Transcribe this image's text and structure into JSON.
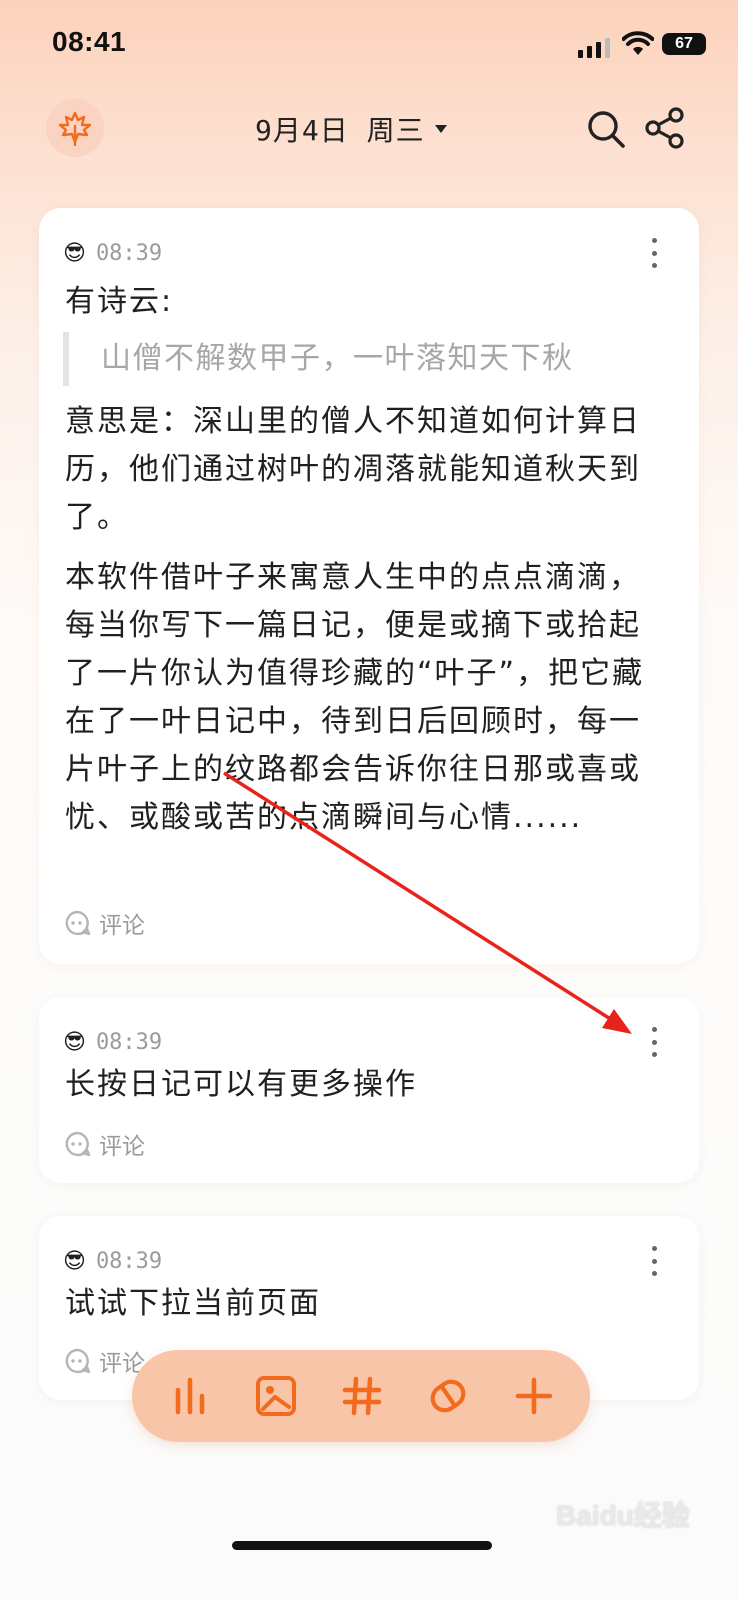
{
  "status_bar": {
    "time": "08:41",
    "battery": "67"
  },
  "header": {
    "date": "9月4日 周三"
  },
  "entries": [
    {
      "mood": "😎",
      "time": "08:39",
      "line1": "有诗云:",
      "quote": "山僧不解数甲子，一叶落知天下秋",
      "paragraph1": "意思是：深山里的僧人不知道如何计算日历，他们通过树叶的凋落就能知道秋天到了。",
      "paragraph2": "本软件借叶子来寓意人生中的点点滴滴，每当你写下一篇日记，便是或摘下或拾起了一片你认为值得珍藏的“叶子”，把它藏在了一叶日记中，待到日后回顾时，每一片叶子上的纹路都会告诉你往日那或喜或忧、或酸或苦的点滴瞬间与心情......",
      "comment_label": "评论"
    },
    {
      "mood": "😎",
      "time": "08:39",
      "text": "长按日记可以有更多操作",
      "comment_label": "评论"
    },
    {
      "mood": "😎",
      "time": "08:39",
      "text": "试试下拉当前页面",
      "comment_label": "评论"
    }
  ],
  "toolbar": {
    "items": [
      "stats-icon",
      "image-icon",
      "hashtag-icon",
      "tag-icon",
      "plus-icon"
    ],
    "accent": "#f26b1d",
    "background": "#f9c5a9"
  },
  "annotation_color": "#e8231b",
  "watermark": "Baidu经验"
}
